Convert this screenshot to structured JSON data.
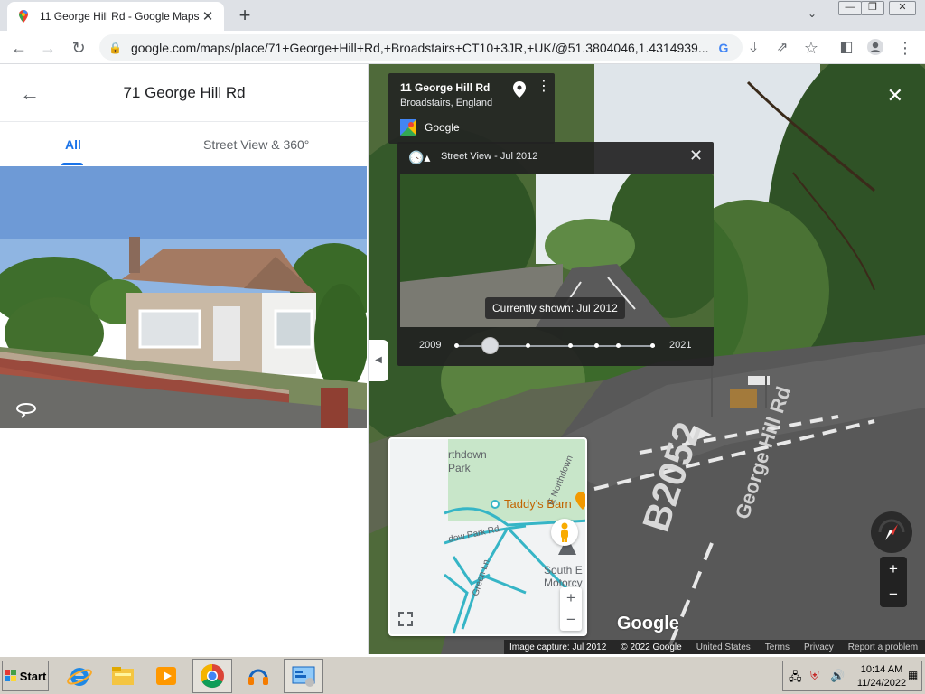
{
  "browser": {
    "tab_title": "11 George Hill Rd - Google Maps",
    "url": "google.com/maps/place/71+George+Hill+Rd,+Broadstairs+CT10+3JR,+UK/@51.3804046,1.4314939..."
  },
  "left_panel": {
    "title": "71 George Hill Rd",
    "tabs": [
      {
        "label": "All",
        "active": true
      },
      {
        "label": "Street View & 360°",
        "active": false
      }
    ]
  },
  "street_view": {
    "address_card": {
      "title": "11 George Hill Rd",
      "subtitle": "Broadstairs, England",
      "source": "Google"
    },
    "time_machine": {
      "title": "Street View - Jul 2012",
      "tooltip": "Currently shown: Jul 2012",
      "year_start": "2009",
      "year_end": "2021",
      "slider_fraction": 0.17
    },
    "minimap": {
      "labels": [
        "rthdown",
        "Park",
        "Taddy's Barn",
        "E Northdown",
        "dow Park Rd",
        "Green Ln",
        "South E",
        "Motorcy"
      ],
      "zoom_in": "+",
      "zoom_out": "−"
    },
    "zoom_in": "+",
    "zoom_out": "−",
    "watermark": "Google",
    "road_markings": [
      "B2052",
      "George Hill Rd"
    ],
    "footer": {
      "capture": "Image capture: Jul 2012",
      "copyright": "© 2022 Google",
      "country": "United States",
      "terms": "Terms",
      "privacy": "Privacy",
      "report": "Report a problem"
    }
  },
  "taskbar": {
    "start_label": "Start",
    "time": "10:14 AM",
    "date": "11/24/2022"
  },
  "colors": {
    "accent_blue": "#1a73e8",
    "panel_dark": "#222222",
    "taskbar": "#d4d0c8"
  }
}
